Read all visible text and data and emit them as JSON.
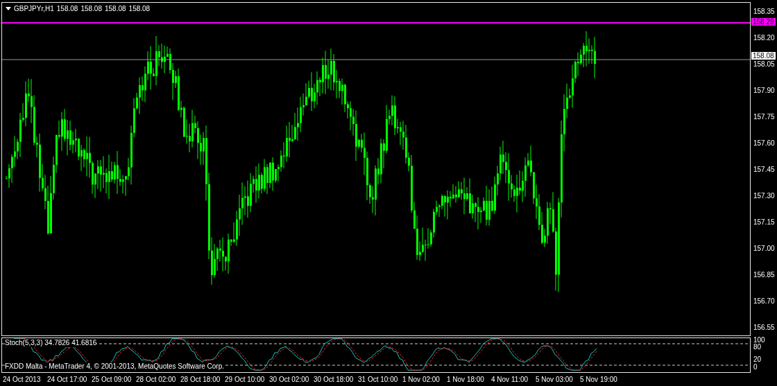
{
  "chart": {
    "symbol": "GBPJPYr,H1",
    "quotes": [
      "158.08",
      "158.08",
      "158.08",
      "158.08"
    ]
  },
  "price_axis": [
    "158.35",
    "158.20",
    "158.05",
    "157.90",
    "157.75",
    "157.60",
    "157.45",
    "157.30",
    "157.15",
    "157.00",
    "156.85",
    "156.70",
    "156.55"
  ],
  "price_markers": [
    {
      "label": "158.29",
      "kind": "level-line",
      "color": "#ff00ff"
    },
    {
      "label": "158.08",
      "kind": "bid-line",
      "color": "#ffffff"
    }
  ],
  "indicator": {
    "label": "Stoch(5,3,3) 34.7826 41.6816",
    "axis": [
      "100",
      "80",
      "20",
      "0"
    ]
  },
  "copyright": "FXDD Malta - MetaTrader 4, © 2001-2013, MetaQuotes Software Corp.",
  "time_axis": [
    "24 Oct 2013",
    "24 Oct 17:00",
    "25 Oct 09:00",
    "28 Oct 02:00",
    "28 Oct 18:00",
    "29 Oct 10:00",
    "30 Oct 02:00",
    "30 Oct 18:00",
    "31 Oct 10:00",
    "1 Nov 02:00",
    "1 Nov 18:00",
    "4 Nov 11:00",
    "5 Nov 03:00",
    "5 Nov 19:00"
  ]
}
